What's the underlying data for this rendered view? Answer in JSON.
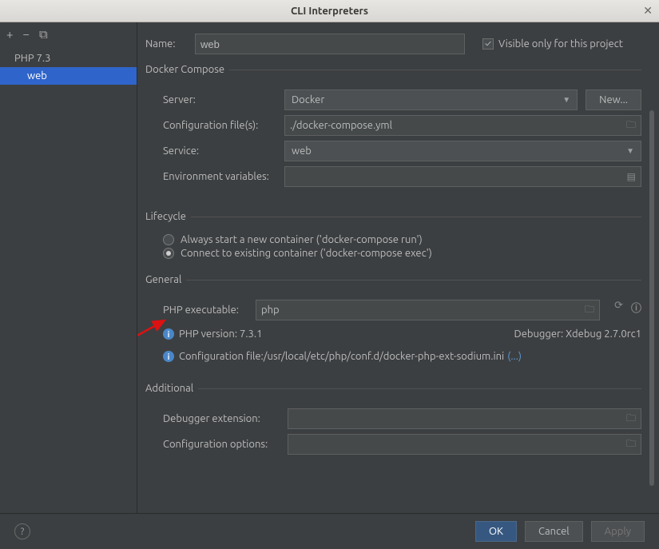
{
  "window": {
    "title": "CLI Interpreters"
  },
  "sidebar": {
    "items": [
      {
        "label": "PHP 7.3"
      },
      {
        "label": "web"
      }
    ]
  },
  "form": {
    "name_label": "Name:",
    "name_value": "web",
    "visible_only_label": "Visible only for this project"
  },
  "docker": {
    "legend": "Docker Compose",
    "server_label": "Server:",
    "server_value": "Docker",
    "new_button": "New...",
    "config_label": "Configuration file(s):",
    "config_value": "./docker-compose.yml",
    "service_label": "Service:",
    "service_value": "web",
    "env_label": "Environment variables:"
  },
  "lifecycle": {
    "legend": "Lifecycle",
    "opt1": "Always start a new container ('docker-compose run')",
    "opt2": "Connect to existing container ('docker-compose exec')"
  },
  "general": {
    "legend": "General",
    "php_exec_label": "PHP executable:",
    "php_exec_value": "php",
    "php_version": "PHP version: 7.3.1",
    "debugger": "Debugger:  Xdebug 2.7.0rc1",
    "config_file_label": "Configuration file: ",
    "config_file_value": "/usr/local/etc/php/conf.d/docker-php-ext-sodium.ini",
    "more_link": "(...)"
  },
  "additional": {
    "legend": "Additional",
    "debugger_ext_label": "Debugger extension:",
    "config_opts_label": "Configuration options:"
  },
  "footer": {
    "ok": "OK",
    "cancel": "Cancel",
    "apply": "Apply"
  }
}
